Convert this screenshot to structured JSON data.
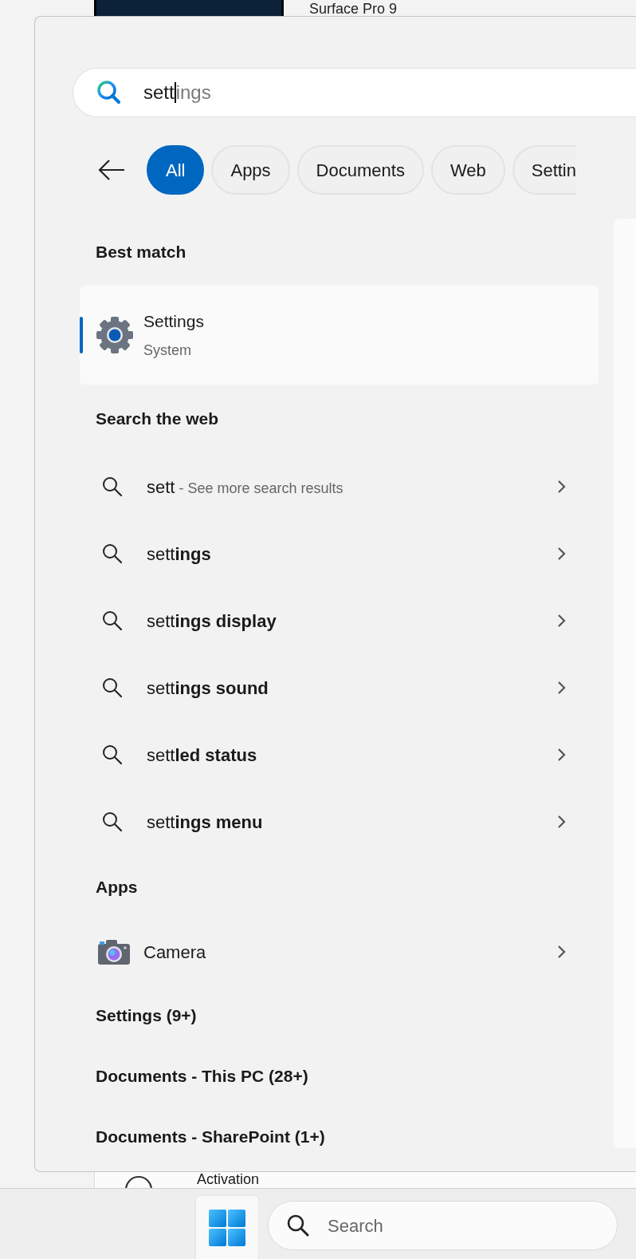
{
  "background": {
    "top_item": {
      "title": "Surface Pro 9"
    },
    "bottom_item": {
      "title": "Activation"
    }
  },
  "search": {
    "value": "sett",
    "completion": "ings"
  },
  "filters": [
    {
      "label": "All",
      "selected": true
    },
    {
      "label": "Apps",
      "selected": false
    },
    {
      "label": "Documents",
      "selected": false
    },
    {
      "label": "Web",
      "selected": false
    },
    {
      "label": "Settin",
      "selected": false
    }
  ],
  "best_match": {
    "heading": "Best match",
    "item": {
      "title": "Settings",
      "subtitle": "System",
      "selected": true
    }
  },
  "web": {
    "heading": "Search the web",
    "items": [
      {
        "text": "sett",
        "detail": "- See more search results"
      },
      {
        "text": "sett**ings**"
      },
      {
        "text": "sett**ings display**"
      },
      {
        "text": "sett**ings sound**"
      },
      {
        "text": "sett**led status**"
      },
      {
        "text": "sett**ings menu**"
      }
    ]
  },
  "apps": {
    "heading": "Apps",
    "items": [
      {
        "title": "Camera"
      }
    ]
  },
  "categories": [
    {
      "label": "Settings (9+)"
    },
    {
      "label": "Documents - This PC (28+)"
    },
    {
      "label": "Documents - SharePoint (1+)"
    }
  ],
  "taskbar": {
    "search": {
      "placeholder": "Search"
    }
  }
}
